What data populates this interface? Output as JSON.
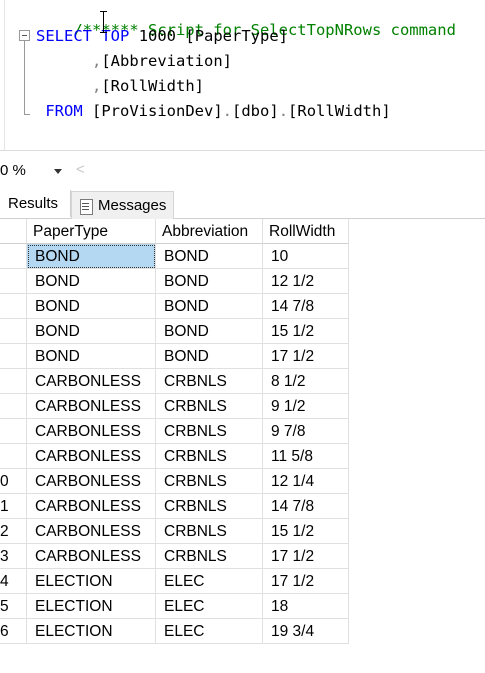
{
  "editor": {
    "comment_line": "/****** Script for SelectTopNRows command",
    "select_kw": "SELECT",
    "top_kw": "TOP",
    "top_count": "1000",
    "col1": "[PaperType]",
    "comma": ",",
    "col2": "[Abbreviation]",
    "col3": "[RollWidth]",
    "from_kw": "FROM",
    "db": "[ProVisionDev]",
    "dot": ".",
    "schema": "[dbo]",
    "table": "[RollWidth]"
  },
  "zoom": {
    "value": "0 %",
    "scroll_left": "<"
  },
  "tabs": {
    "results": "Results",
    "messages": "Messages"
  },
  "grid": {
    "headers": [
      "PaperType",
      "Abbreviation",
      "RollWidth"
    ],
    "rows": [
      {
        "n": "",
        "paper": "BOND",
        "abbr": "BOND",
        "width": "10"
      },
      {
        "n": "",
        "paper": "BOND",
        "abbr": "BOND",
        "width": "12 1/2"
      },
      {
        "n": "",
        "paper": "BOND",
        "abbr": "BOND",
        "width": "14 7/8"
      },
      {
        "n": "",
        "paper": "BOND",
        "abbr": "BOND",
        "width": "15 1/2"
      },
      {
        "n": "",
        "paper": "BOND",
        "abbr": "BOND",
        "width": "17 1/2"
      },
      {
        "n": "",
        "paper": "CARBONLESS",
        "abbr": "CRBNLS",
        "width": "8 1/2"
      },
      {
        "n": "",
        "paper": "CARBONLESS",
        "abbr": "CRBNLS",
        "width": "9 1/2"
      },
      {
        "n": "",
        "paper": "CARBONLESS",
        "abbr": "CRBNLS",
        "width": "9 7/8"
      },
      {
        "n": "",
        "paper": "CARBONLESS",
        "abbr": "CRBNLS",
        "width": "11 5/8"
      },
      {
        "n": "0",
        "paper": "CARBONLESS",
        "abbr": "CRBNLS",
        "width": "12 1/4"
      },
      {
        "n": "1",
        "paper": "CARBONLESS",
        "abbr": "CRBNLS",
        "width": "14 7/8"
      },
      {
        "n": "2",
        "paper": "CARBONLESS",
        "abbr": "CRBNLS",
        "width": "15 1/2"
      },
      {
        "n": "3",
        "paper": "CARBONLESS",
        "abbr": "CRBNLS",
        "width": "17 1/2"
      },
      {
        "n": "4",
        "paper": "ELECTION",
        "abbr": "ELEC",
        "width": "17 1/2"
      },
      {
        "n": "5",
        "paper": "ELECTION",
        "abbr": "ELEC",
        "width": "18"
      },
      {
        "n": "6",
        "paper": "ELECTION",
        "abbr": "ELEC",
        "width": "19 3/4"
      }
    ]
  },
  "colors": {
    "keyword": "#0000ff",
    "comment": "#008000",
    "selection": "#b4d7f2"
  }
}
